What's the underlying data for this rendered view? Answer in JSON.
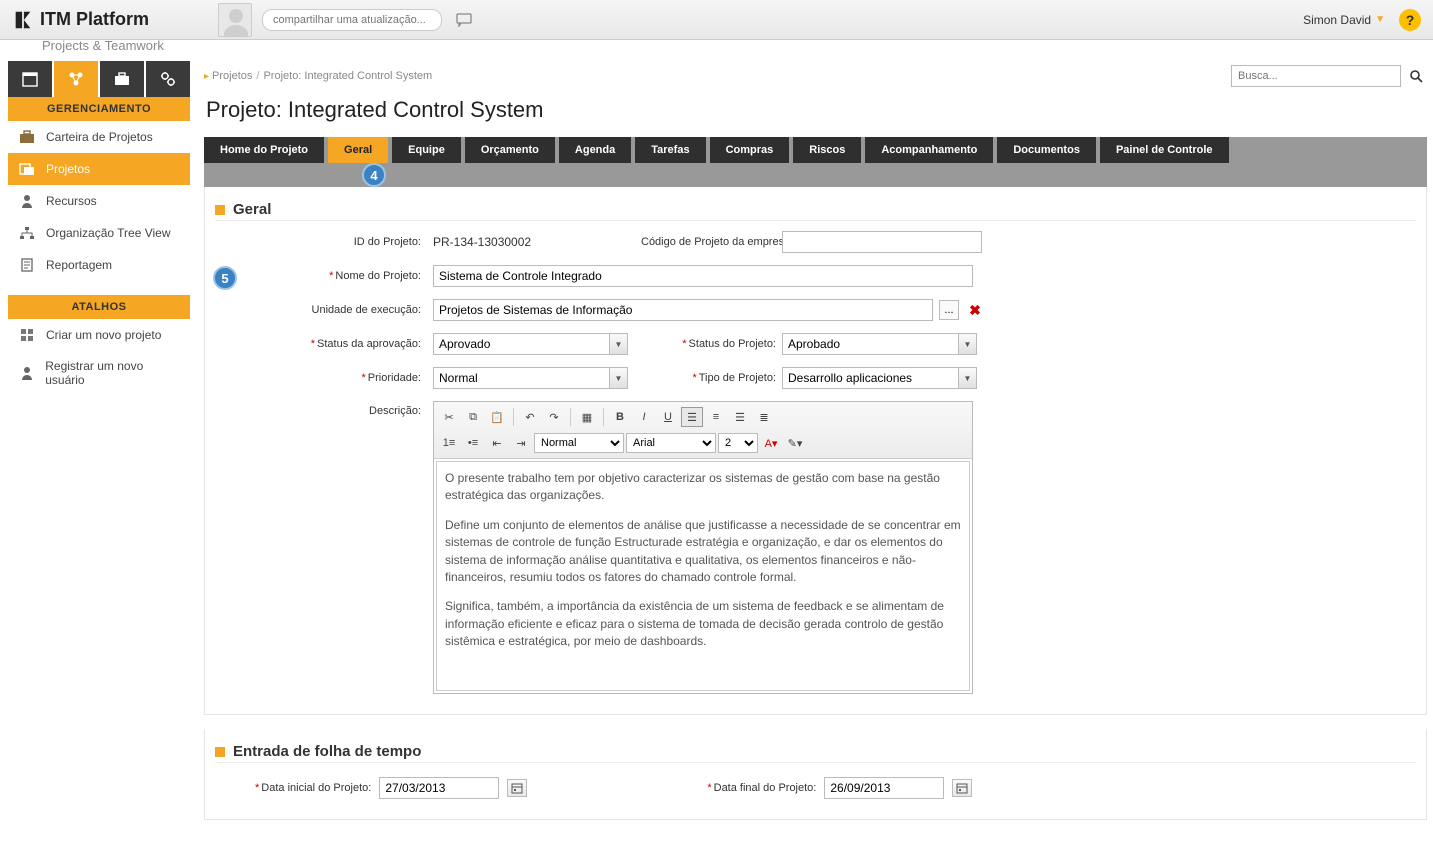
{
  "brand": {
    "name": "ITM Platform",
    "subtitle": "Projects & Teamwork"
  },
  "topbar": {
    "share_placeholder": "compartilhar uma atualização...",
    "username": "Simon David",
    "help": "?"
  },
  "breadcrumb": {
    "item1": "Projetos",
    "item2": "Projeto: Integrated Control System",
    "search_placeholder": "Busca..."
  },
  "page": {
    "title": "Projeto: Integrated Control System"
  },
  "tabs": [
    "Home do Projeto",
    "Geral",
    "Equipe",
    "Orçamento",
    "Agenda",
    "Tarefas",
    "Compras",
    "Riscos",
    "Acompanhamento",
    "Documentos",
    "Painel de Controle"
  ],
  "sidebar": {
    "section": "GERENCIAMENTO",
    "items": [
      "Carteira de Projetos",
      "Projetos",
      "Recursos",
      "Organização Tree View",
      "Reportagem"
    ],
    "shortcuts_header": "ATALHOS",
    "shortcuts": [
      "Criar um novo projeto",
      "Registrar um novo usuário"
    ]
  },
  "step_badges": {
    "tab": "4",
    "name": "5"
  },
  "general": {
    "panel_title": "Geral",
    "labels": {
      "project_id": "ID do Projeto:",
      "company_code": "Código de Projeto da empresa:",
      "project_name": "Nome do Projeto:",
      "exec_unit": "Unidade de execução:",
      "approval_status": "Status da aprovação:",
      "project_status": "Status do Projeto:",
      "priority": "Prioridade:",
      "project_type": "Tipo de Projeto:",
      "description": "Descrição:"
    },
    "values": {
      "project_id": "PR-134-13030002",
      "company_code": "",
      "project_name": "Sistema de Controle Integrado",
      "exec_unit": "Projetos de Sistemas de Informação",
      "approval_status": "Aprovado",
      "project_status": "Aprobado",
      "priority": "Normal",
      "project_type": "Desarrollo aplicaciones"
    },
    "description_paragraphs": [
      "O presente trabalho tem por objetivo caracterizar os sistemas de gestão com base na gestão estratégica das organizações.",
      "Define um conjunto de elementos de análise que justificasse a necessidade de se concentrar em sistemas de controle de função Estructurade estratégia e organização, e dar os elementos do sistema de informação análise quantitativa e qualitativa, os elementos financeiros e não-financeiros, resumiu todos os fatores do chamado controle formal.",
      "Significa, também, a importância da existência de um sistema de feedback e se alimentam de informação eficiente e eficaz para o sistema de tomada de decisão gerada controlo de gestão sistêmica e estratégica, por meio de dashboards."
    ],
    "rte": {
      "format": "Normal",
      "font": "Arial",
      "size": "2"
    }
  },
  "timesheet": {
    "panel_title": "Entrada de folha de tempo",
    "start_label": "Data inicial do Projeto:",
    "end_label": "Data final do Projeto:",
    "start": "27/03/2013",
    "end": "26/09/2013"
  }
}
